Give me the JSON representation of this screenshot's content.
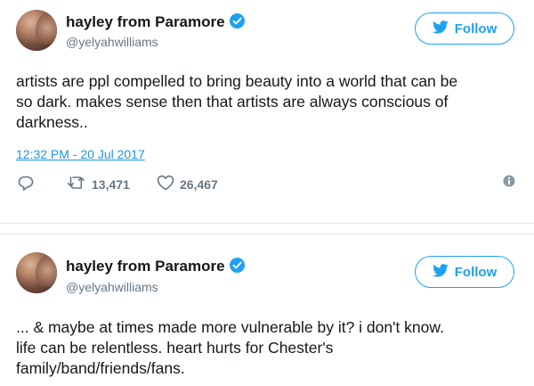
{
  "tweets": [
    {
      "author": {
        "name": "hayley from Paramore",
        "handle": "@yelyahwilliams",
        "avatar_icon": "avatar-photo",
        "verified_icon": "verified-badge-icon"
      },
      "follow_label": "Follow",
      "text_lines": [
        "artists are ppl compelled to bring beauty into a world that can be",
        "so dark. makes sense then that artists are always conscious of",
        "darkness.."
      ],
      "timestamp": "12:32 PM - 20 Jul 2017",
      "retweets": "13,471",
      "likes": "26,467"
    },
    {
      "author": {
        "name": "hayley from Paramore",
        "handle": "@yelyahwilliams",
        "avatar_icon": "avatar-photo",
        "verified_icon": "verified-badge-icon"
      },
      "follow_label": "Follow",
      "text_lines": [
        "... & maybe at times made more vulnerable by it? i don't know.",
        "life can be relentless. heart hurts for Chester's",
        "family/band/friends/fans."
      ]
    }
  ],
  "colors": {
    "accent": "#1da1f2",
    "link": "#1b95e0",
    "muted": "#657786",
    "text": "#14171a"
  }
}
